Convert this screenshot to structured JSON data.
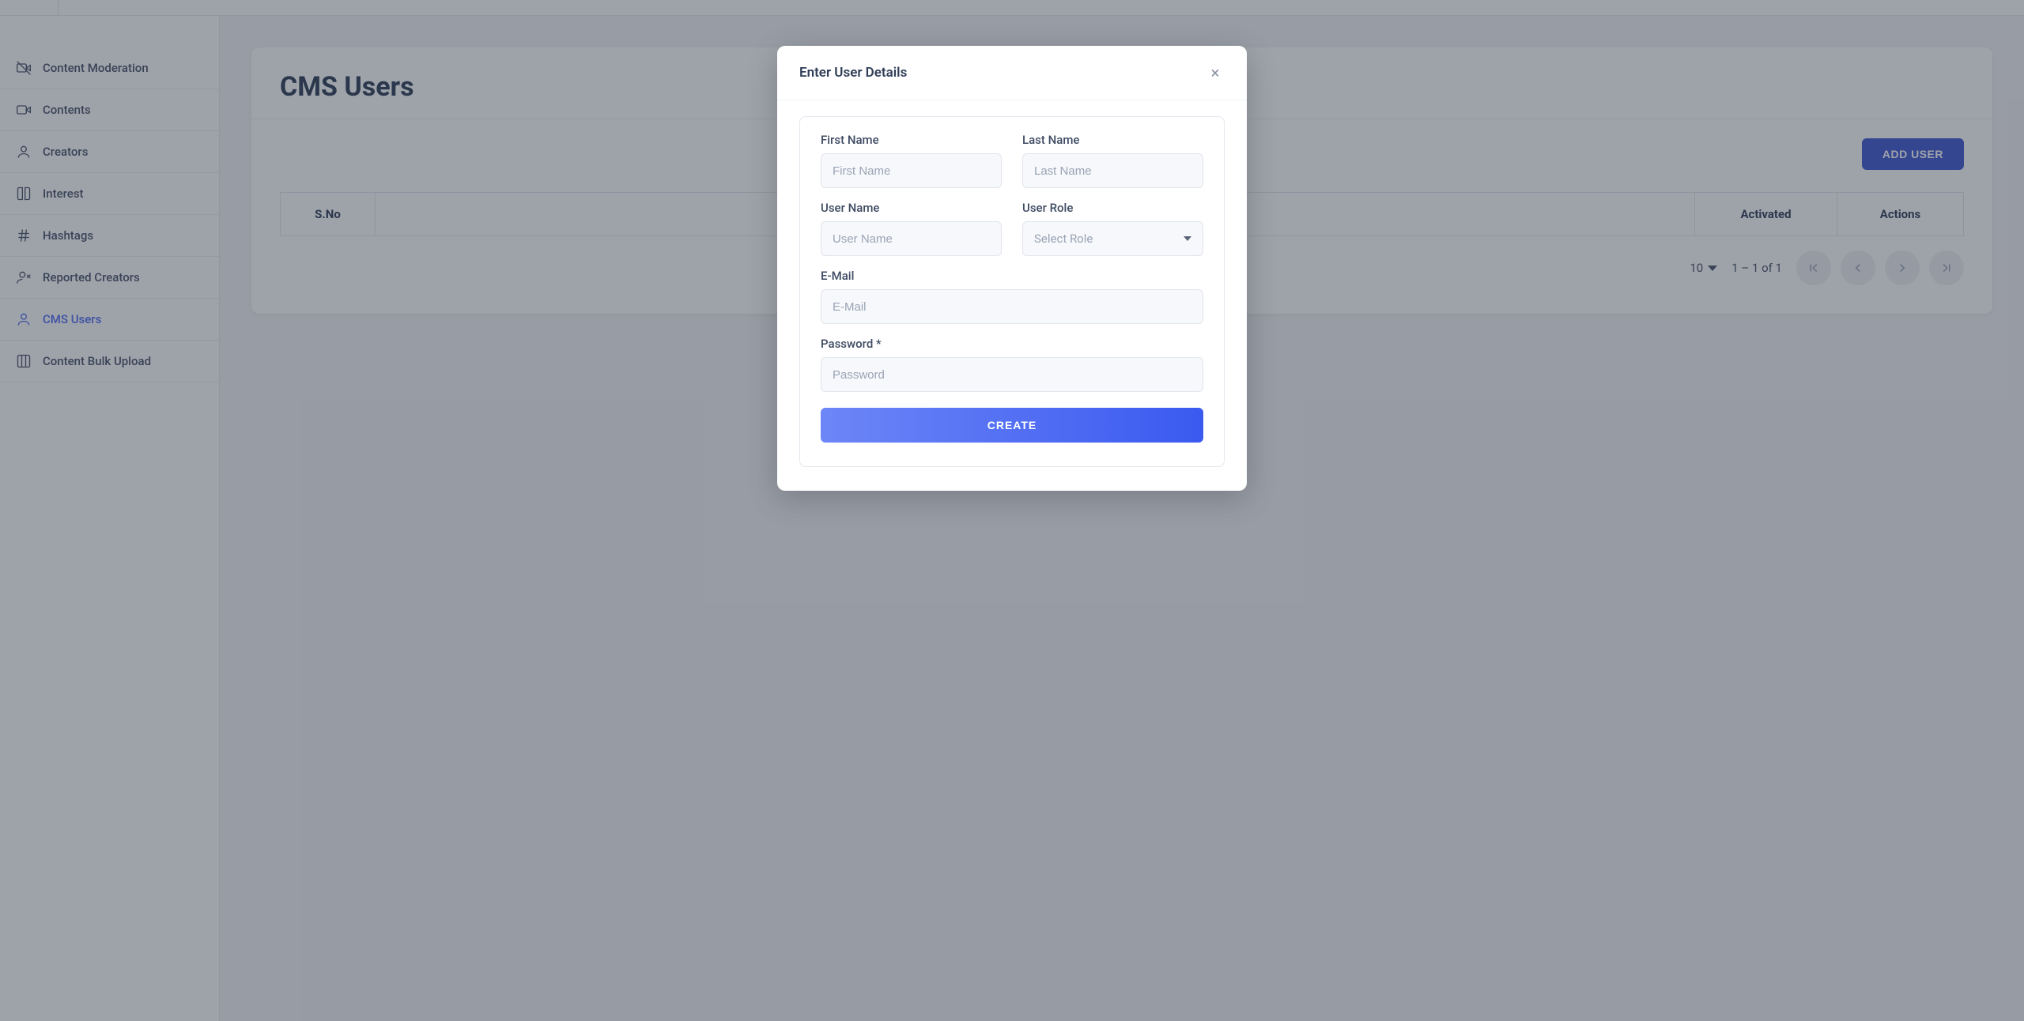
{
  "sidebar": {
    "items": [
      {
        "label": "Content Moderation"
      },
      {
        "label": "Contents"
      },
      {
        "label": "Creators"
      },
      {
        "label": "Interest"
      },
      {
        "label": "Hashtags"
      },
      {
        "label": "Reported Creators"
      },
      {
        "label": "CMS Users"
      },
      {
        "label": "Content Bulk Upload"
      }
    ]
  },
  "page": {
    "title": "CMS Users",
    "add_button": "ADD USER",
    "columns": {
      "sno": "S.No",
      "activated": "Activated",
      "actions": "Actions"
    },
    "pager": {
      "page_size": "10",
      "range": "1 – 1 of 1"
    }
  },
  "modal": {
    "title": "Enter User Details",
    "labels": {
      "first_name": "First Name",
      "last_name": "Last Name",
      "user_name": "User Name",
      "user_role": "User Role",
      "email": "E-Mail",
      "password": "Password *"
    },
    "placeholders": {
      "first_name": "First Name",
      "last_name": "Last Name",
      "user_name": "User Name",
      "select_role": "Select Role",
      "email": "E-Mail",
      "password": "Password"
    },
    "create_button": "CREATE"
  }
}
